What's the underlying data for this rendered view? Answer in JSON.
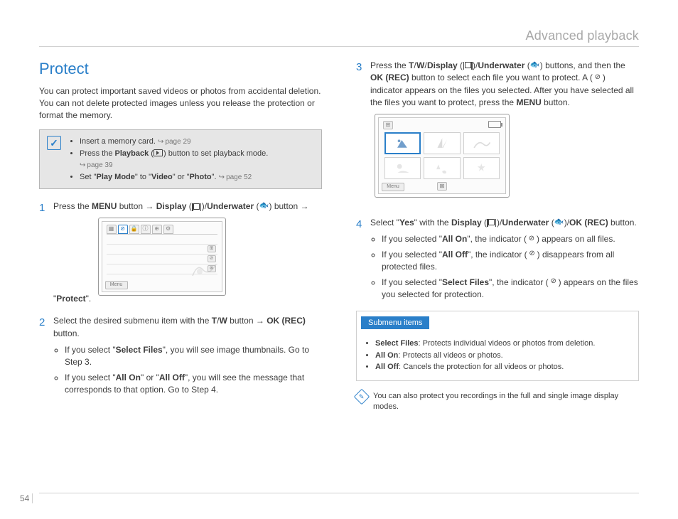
{
  "header": {
    "section": "Advanced playback"
  },
  "page_number": "54",
  "protect": {
    "title": "Protect",
    "intro": "You can protect important saved videos or photos from accidental deletion. You can not delete protected images unless you release the protection or format the memory.",
    "callout": {
      "items": {
        "0": {
          "text_a": "Insert a memory card. ",
          "ref": "page 29"
        },
        "1": {
          "text_a": "Press the ",
          "bold_a": "Playback",
          "text_b": " (",
          "text_c": ") button to set playback mode.",
          "ref": "page 39"
        },
        "2": {
          "text_a": "Set \"",
          "bold_a": "Play Mode",
          "text_b": "\" to \"",
          "bold_b": "Video",
          "text_c": "\" or \"",
          "bold_c": "Photo",
          "text_d": "\". ",
          "ref": "page 52"
        }
      }
    },
    "screen1_menu_label": "Menu"
  },
  "steps": {
    "1": {
      "num": "1",
      "a": "Press the ",
      "b": "MENU",
      "c": " button ",
      "arrow1": "→",
      "d": " ",
      "e": "Display",
      "f": " (",
      "g": ")/",
      "h": "Underwater",
      "i": " (",
      "j": ") button ",
      "arrow2": "→",
      "k": " \"",
      "l": "Protect",
      "m": "\"."
    },
    "2": {
      "num": "2",
      "a": "Select the desired submenu item with the ",
      "b": "T",
      "c": "/",
      "d": "W",
      "e": " button ",
      "arrow": "→",
      "f": " ",
      "g": "OK (REC)",
      "h": " button.",
      "sub": {
        "0": {
          "a": "If you select \"",
          "b": "Select Files",
          "c": "\", you will see image thumbnails. Go to Step 3."
        },
        "1": {
          "a": "If you select \"",
          "b": "All On",
          "c": "\" or \"",
          "d": "All Off",
          "e": "\", you will see the message that corresponds to that option. Go to Step 4."
        }
      }
    },
    "3": {
      "num": "3",
      "a": "Press the ",
      "b": "T",
      "c": "/",
      "d": "W",
      "e": "/",
      "f": "Display",
      "g": " (",
      "h": ")/",
      "i": "Underwater",
      "j": " (",
      "k": ") buttons, and then the ",
      "l": "OK (REC)",
      "m": " button to select each file you want to protect. A (",
      "n": ") indicator appears on the files you selected. After you have selected all the files you want to protect, press the ",
      "o": "MENU",
      "p": " button."
    },
    "4": {
      "num": "4",
      "a": "Select \"",
      "b": "Yes",
      "c": "\" with the ",
      "d": "Display",
      "e": " (",
      "f": ")/",
      "g": "Underwater",
      "h": " (",
      "i": ")/",
      "j": "OK (REC)",
      "k": " button.",
      "sub": {
        "0": {
          "a": "If you selected \"",
          "b": "All On",
          "c": "\", the indicator (",
          "d": ") appears on all files."
        },
        "1": {
          "a": "If you selected \"",
          "b": "All Off",
          "c": "\", the indicator (",
          "d": ") disappears from all protected files."
        },
        "2": {
          "a": "If you selected \"",
          "b": "Select Files",
          "c": "\", the indicator (",
          "d": ") appears on the files you selected for protection."
        }
      }
    }
  },
  "submenu": {
    "head": "Submenu items",
    "items": {
      "0": {
        "b": "Select Files",
        "t": ": Protects individual videos or photos from deletion."
      },
      "1": {
        "b": "All On",
        "t": ": Protects all videos or photos."
      },
      "2": {
        "b": "All Off",
        "t": ": Cancels the protection for all videos or photos."
      }
    }
  },
  "note": {
    "text": "You can also protect you recordings in the full and single image display modes."
  }
}
